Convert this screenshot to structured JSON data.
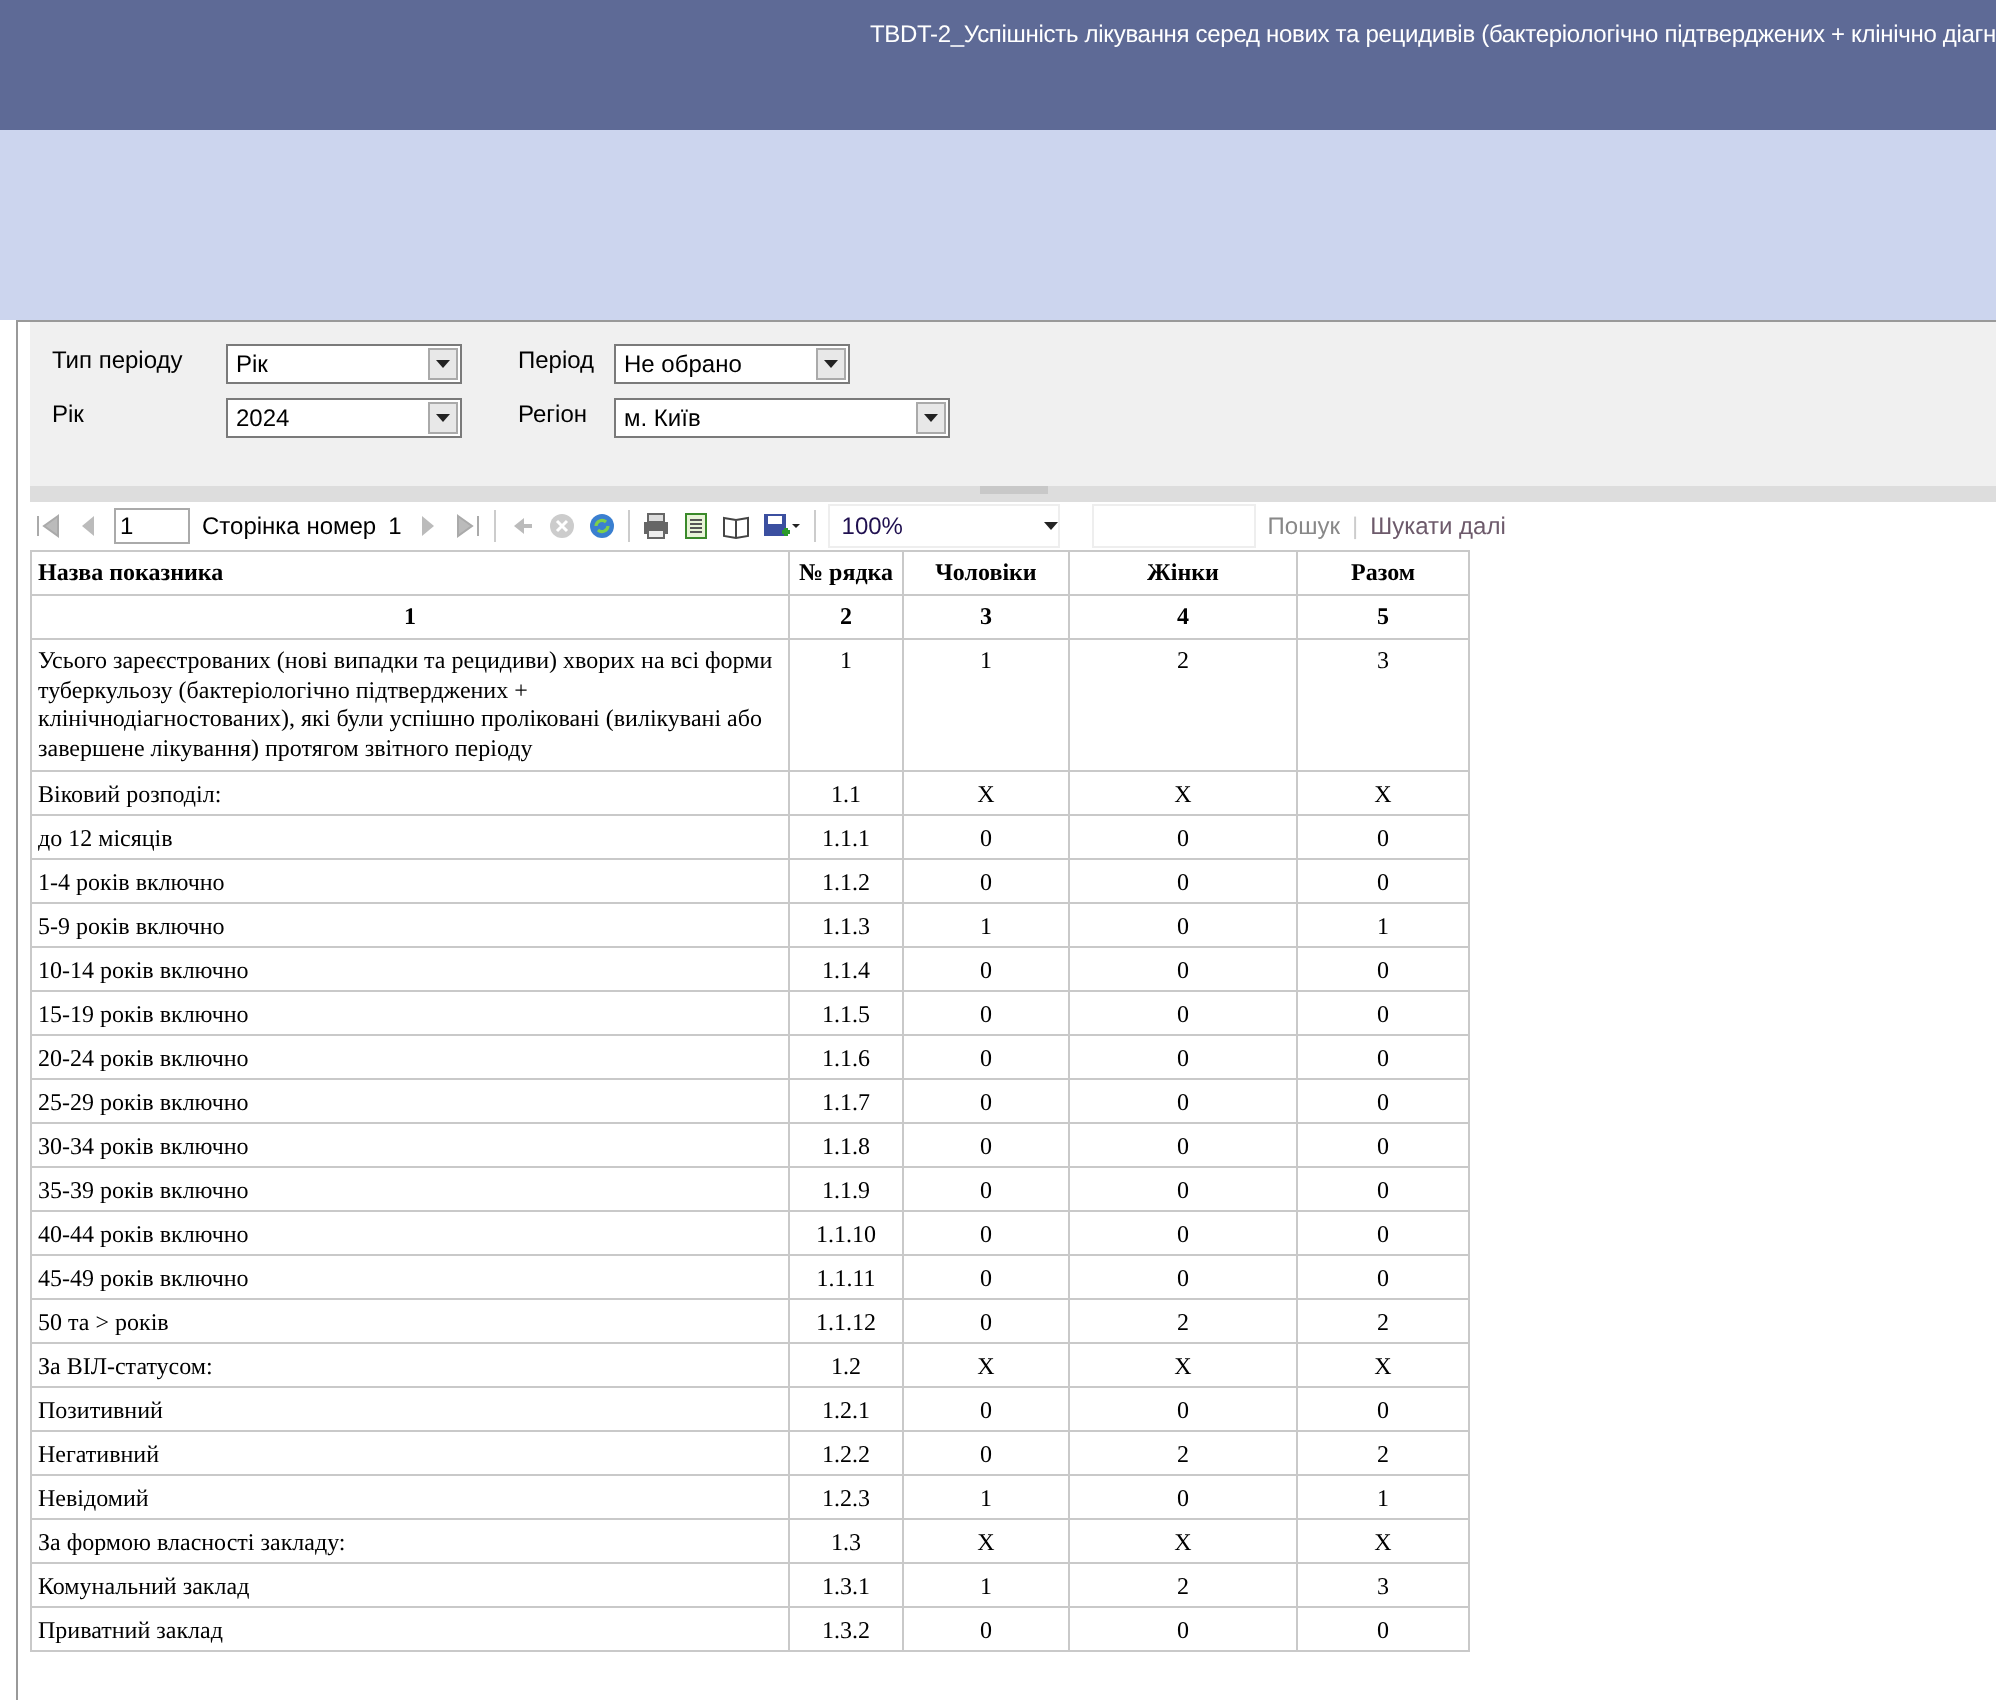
{
  "header": {
    "title": "TBDT-2_Успішність лікування серед нових та рецидивів (бактеріологічно підтверджених + клінічно діагн"
  },
  "parameters": [
    {
      "label": "Тип періоду",
      "value": "Рік",
      "wide": false
    },
    {
      "label": "Період",
      "value": "Не обрано",
      "wide": false
    },
    {
      "label": "Рік",
      "value": "2024",
      "wide": false
    },
    {
      "label": "Регіон",
      "value": "м. Київ",
      "wide": true
    }
  ],
  "toolbar": {
    "page": "1",
    "page_label": "Сторінка номер",
    "page_count": "1",
    "zoom": "100%",
    "find": "Пошук",
    "separator": "|",
    "find_next": "Шукати далі"
  },
  "table": {
    "columns": [
      "Назва показника",
      "№ рядка",
      "Чоловіки",
      "Жінки",
      "Разом"
    ],
    "column_numbers": [
      "1",
      "2",
      "3",
      "4",
      "5"
    ],
    "rows": [
      [
        "Усього зареєстрованих (нові випадки та рецидиви) хворих на всі форми туберкульозу (бактеріологічно підтверджених + клінічнодіагностованих), які були успішно проліковані (вилікувані або завершене лікування) протягом звітного періоду",
        "1",
        "1",
        "2",
        "3"
      ],
      [
        "Віковий розподіл:",
        "1.1",
        "X",
        "X",
        "X"
      ],
      [
        "до 12 місяців",
        "1.1.1",
        "0",
        "0",
        "0"
      ],
      [
        "1-4 років включно",
        "1.1.2",
        "0",
        "0",
        "0"
      ],
      [
        "5-9 років включно",
        "1.1.3",
        "1",
        "0",
        "1"
      ],
      [
        "10-14 років включно",
        "1.1.4",
        "0",
        "0",
        "0"
      ],
      [
        "15-19 років включно",
        "1.1.5",
        "0",
        "0",
        "0"
      ],
      [
        "20-24 років включно",
        "1.1.6",
        "0",
        "0",
        "0"
      ],
      [
        "25-29 років включно",
        "1.1.7",
        "0",
        "0",
        "0"
      ],
      [
        "30-34 років включно",
        "1.1.8",
        "0",
        "0",
        "0"
      ],
      [
        "35-39 років включно",
        "1.1.9",
        "0",
        "0",
        "0"
      ],
      [
        "40-44 років включно",
        "1.1.10",
        "0",
        "0",
        "0"
      ],
      [
        "45-49 років включно",
        "1.1.11",
        "0",
        "0",
        "0"
      ],
      [
        "50 та > років",
        "1.1.12",
        "0",
        "2",
        "2"
      ],
      [
        "За ВІЛ-статусом:",
        "1.2",
        "X",
        "X",
        "X"
      ],
      [
        "Позитивний",
        "1.2.1",
        "0",
        "0",
        "0"
      ],
      [
        "Негативний",
        "1.2.2",
        "0",
        "2",
        "2"
      ],
      [
        "Невідомий",
        "1.2.3",
        "1",
        "0",
        "1"
      ],
      [
        "За формою власності закладу:",
        "1.3",
        "X",
        "X",
        "X"
      ],
      [
        "Комунальний заклад",
        "1.3.1",
        "1",
        "2",
        "3"
      ],
      [
        "Приватний заклад",
        "1.3.2",
        "0",
        "0",
        "0"
      ]
    ]
  }
}
